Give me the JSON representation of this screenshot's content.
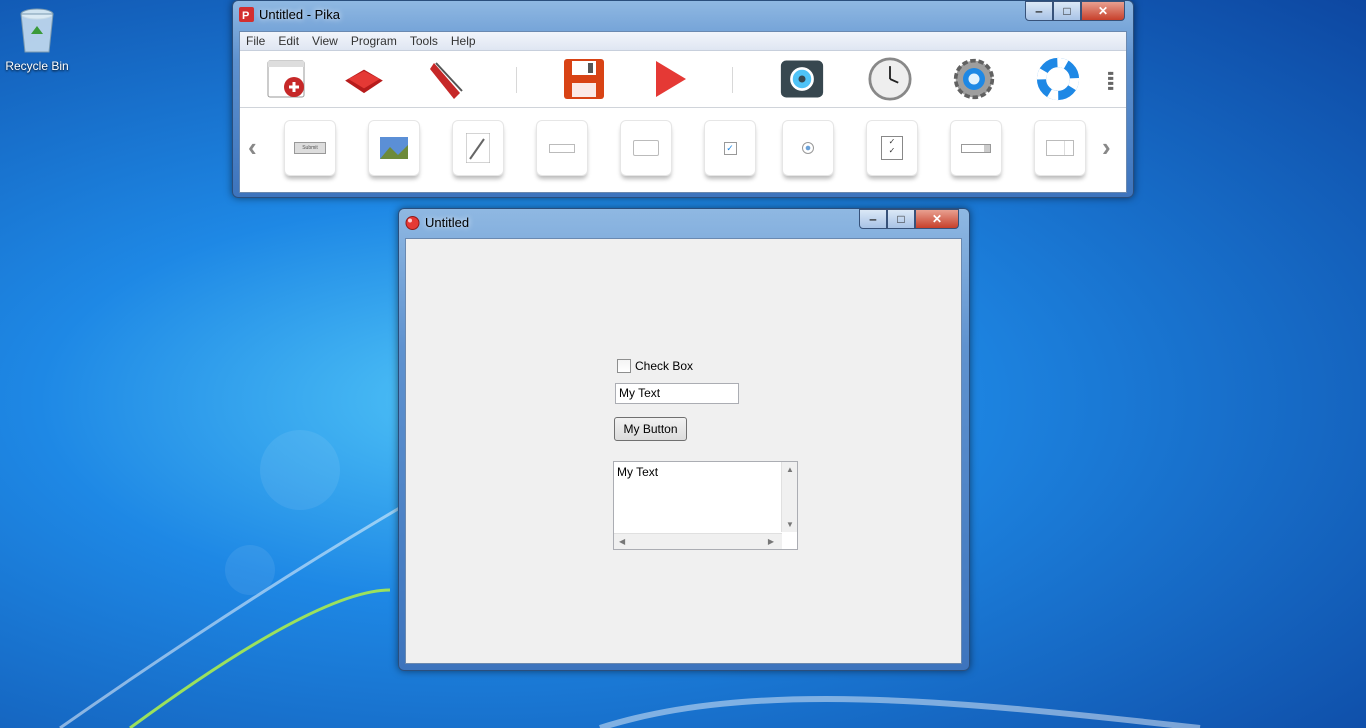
{
  "desktop": {
    "recycle_bin_label": "Recycle Bin"
  },
  "main_window": {
    "title": "Untitled - Pika",
    "menu": [
      "File",
      "Edit",
      "View",
      "Program",
      "Tools",
      "Help"
    ],
    "toolbar_icons": [
      "new-form-icon",
      "open-icon",
      "stapler-icon",
      "save-icon",
      "run-icon",
      "settings-icon",
      "clock-icon",
      "gear-icon",
      "help-lifebuoy-icon"
    ],
    "widget_palette": [
      "button-widget-icon",
      "image-widget-icon",
      "memo-widget-icon",
      "textbox-widget-icon",
      "panel-widget-icon",
      "checkbox-widget-icon",
      "radio-widget-icon",
      "checklist-widget-icon",
      "combobox-widget-icon",
      "spinner-widget-icon"
    ],
    "submit_tile_text": "Submit"
  },
  "form_window": {
    "title": "Untitled",
    "checkbox_label": "Check Box",
    "checkbox_checked": false,
    "textbox_value": "My Text",
    "button_label": "My Button",
    "memo_value": "My Text"
  },
  "colors": {
    "desktop_blue": "#1e88e5",
    "form_background": "#f0f0f0",
    "close_button_red": "#c7402b"
  }
}
